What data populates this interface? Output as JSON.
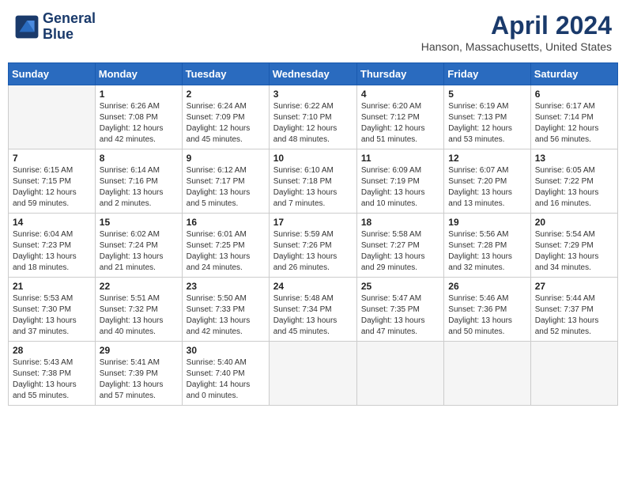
{
  "header": {
    "logo_line1": "General",
    "logo_line2": "Blue",
    "month_year": "April 2024",
    "location": "Hanson, Massachusetts, United States"
  },
  "weekdays": [
    "Sunday",
    "Monday",
    "Tuesday",
    "Wednesday",
    "Thursday",
    "Friday",
    "Saturday"
  ],
  "weeks": [
    [
      {
        "day": "",
        "info": ""
      },
      {
        "day": "1",
        "info": "Sunrise: 6:26 AM\nSunset: 7:08 PM\nDaylight: 12 hours\nand 42 minutes."
      },
      {
        "day": "2",
        "info": "Sunrise: 6:24 AM\nSunset: 7:09 PM\nDaylight: 12 hours\nand 45 minutes."
      },
      {
        "day": "3",
        "info": "Sunrise: 6:22 AM\nSunset: 7:10 PM\nDaylight: 12 hours\nand 48 minutes."
      },
      {
        "day": "4",
        "info": "Sunrise: 6:20 AM\nSunset: 7:12 PM\nDaylight: 12 hours\nand 51 minutes."
      },
      {
        "day": "5",
        "info": "Sunrise: 6:19 AM\nSunset: 7:13 PM\nDaylight: 12 hours\nand 53 minutes."
      },
      {
        "day": "6",
        "info": "Sunrise: 6:17 AM\nSunset: 7:14 PM\nDaylight: 12 hours\nand 56 minutes."
      }
    ],
    [
      {
        "day": "7",
        "info": "Sunrise: 6:15 AM\nSunset: 7:15 PM\nDaylight: 12 hours\nand 59 minutes."
      },
      {
        "day": "8",
        "info": "Sunrise: 6:14 AM\nSunset: 7:16 PM\nDaylight: 13 hours\nand 2 minutes."
      },
      {
        "day": "9",
        "info": "Sunrise: 6:12 AM\nSunset: 7:17 PM\nDaylight: 13 hours\nand 5 minutes."
      },
      {
        "day": "10",
        "info": "Sunrise: 6:10 AM\nSunset: 7:18 PM\nDaylight: 13 hours\nand 7 minutes."
      },
      {
        "day": "11",
        "info": "Sunrise: 6:09 AM\nSunset: 7:19 PM\nDaylight: 13 hours\nand 10 minutes."
      },
      {
        "day": "12",
        "info": "Sunrise: 6:07 AM\nSunset: 7:20 PM\nDaylight: 13 hours\nand 13 minutes."
      },
      {
        "day": "13",
        "info": "Sunrise: 6:05 AM\nSunset: 7:22 PM\nDaylight: 13 hours\nand 16 minutes."
      }
    ],
    [
      {
        "day": "14",
        "info": "Sunrise: 6:04 AM\nSunset: 7:23 PM\nDaylight: 13 hours\nand 18 minutes."
      },
      {
        "day": "15",
        "info": "Sunrise: 6:02 AM\nSunset: 7:24 PM\nDaylight: 13 hours\nand 21 minutes."
      },
      {
        "day": "16",
        "info": "Sunrise: 6:01 AM\nSunset: 7:25 PM\nDaylight: 13 hours\nand 24 minutes."
      },
      {
        "day": "17",
        "info": "Sunrise: 5:59 AM\nSunset: 7:26 PM\nDaylight: 13 hours\nand 26 minutes."
      },
      {
        "day": "18",
        "info": "Sunrise: 5:58 AM\nSunset: 7:27 PM\nDaylight: 13 hours\nand 29 minutes."
      },
      {
        "day": "19",
        "info": "Sunrise: 5:56 AM\nSunset: 7:28 PM\nDaylight: 13 hours\nand 32 minutes."
      },
      {
        "day": "20",
        "info": "Sunrise: 5:54 AM\nSunset: 7:29 PM\nDaylight: 13 hours\nand 34 minutes."
      }
    ],
    [
      {
        "day": "21",
        "info": "Sunrise: 5:53 AM\nSunset: 7:30 PM\nDaylight: 13 hours\nand 37 minutes."
      },
      {
        "day": "22",
        "info": "Sunrise: 5:51 AM\nSunset: 7:32 PM\nDaylight: 13 hours\nand 40 minutes."
      },
      {
        "day": "23",
        "info": "Sunrise: 5:50 AM\nSunset: 7:33 PM\nDaylight: 13 hours\nand 42 minutes."
      },
      {
        "day": "24",
        "info": "Sunrise: 5:48 AM\nSunset: 7:34 PM\nDaylight: 13 hours\nand 45 minutes."
      },
      {
        "day": "25",
        "info": "Sunrise: 5:47 AM\nSunset: 7:35 PM\nDaylight: 13 hours\nand 47 minutes."
      },
      {
        "day": "26",
        "info": "Sunrise: 5:46 AM\nSunset: 7:36 PM\nDaylight: 13 hours\nand 50 minutes."
      },
      {
        "day": "27",
        "info": "Sunrise: 5:44 AM\nSunset: 7:37 PM\nDaylight: 13 hours\nand 52 minutes."
      }
    ],
    [
      {
        "day": "28",
        "info": "Sunrise: 5:43 AM\nSunset: 7:38 PM\nDaylight: 13 hours\nand 55 minutes."
      },
      {
        "day": "29",
        "info": "Sunrise: 5:41 AM\nSunset: 7:39 PM\nDaylight: 13 hours\nand 57 minutes."
      },
      {
        "day": "30",
        "info": "Sunrise: 5:40 AM\nSunset: 7:40 PM\nDaylight: 14 hours\nand 0 minutes."
      },
      {
        "day": "",
        "info": ""
      },
      {
        "day": "",
        "info": ""
      },
      {
        "day": "",
        "info": ""
      },
      {
        "day": "",
        "info": ""
      }
    ]
  ]
}
